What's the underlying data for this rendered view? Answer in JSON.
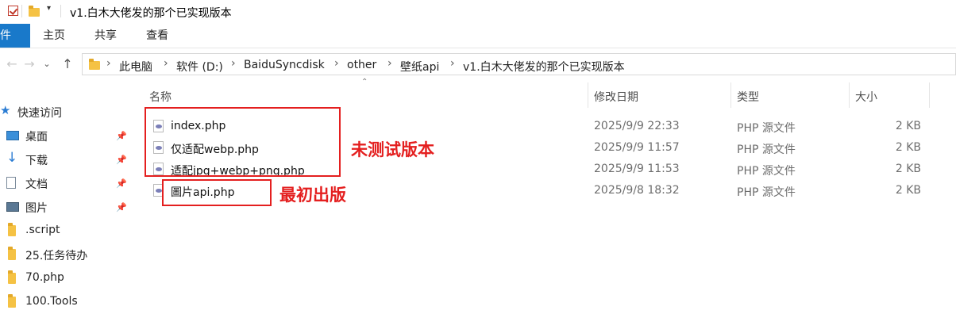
{
  "window": {
    "title": "v1.白木大佬发的那个已实现版本"
  },
  "ribbon": {
    "tabs": [
      "件",
      "主页",
      "共享",
      "查看"
    ]
  },
  "address": {
    "breadcrumbs": [
      "此电脑",
      "软件 (D:)",
      "BaiduSyncdisk",
      "other",
      "壁纸api",
      "v1.白木大佬发的那个已实现版本"
    ]
  },
  "sidebar": {
    "items": [
      {
        "label": "快速访问",
        "icon": "star-icon"
      },
      {
        "label": "桌面",
        "icon": "desktop-icon",
        "pinned": true
      },
      {
        "label": "下载",
        "icon": "download-icon",
        "pinned": true
      },
      {
        "label": "文档",
        "icon": "document-icon",
        "pinned": true
      },
      {
        "label": "图片",
        "icon": "pictures-icon",
        "pinned": true
      },
      {
        "label": ".script",
        "icon": "folder-icon"
      },
      {
        "label": "25.任务待办",
        "icon": "folder-icon"
      },
      {
        "label": "70.php",
        "icon": "folder-icon"
      },
      {
        "label": "100.Tools",
        "icon": "folder-icon"
      }
    ]
  },
  "file_list": {
    "columns": [
      "名称",
      "修改日期",
      "类型",
      "大小"
    ],
    "rows": [
      {
        "name": "index.php",
        "modified": "2025/9/9 22:33",
        "type": "PHP 源文件",
        "size": "2 KB"
      },
      {
        "name": "仅适配webp.php",
        "modified": "2025/9/9 11:57",
        "type": "PHP 源文件",
        "size": "2 KB"
      },
      {
        "name": "适配jpg+webp+png.php",
        "modified": "2025/9/9 11:53",
        "type": "PHP 源文件",
        "size": "2 KB"
      },
      {
        "name": "圖片api.php",
        "modified": "2025/9/8 18:32",
        "type": "PHP 源文件",
        "size": "2 KB"
      }
    ]
  },
  "annotations": {
    "untested_label": "未测试版本",
    "first_version_label": "最初出版"
  },
  "colors": {
    "annotation_red": "#e41f1f",
    "ribbon_file_tab": "#1979ca"
  }
}
